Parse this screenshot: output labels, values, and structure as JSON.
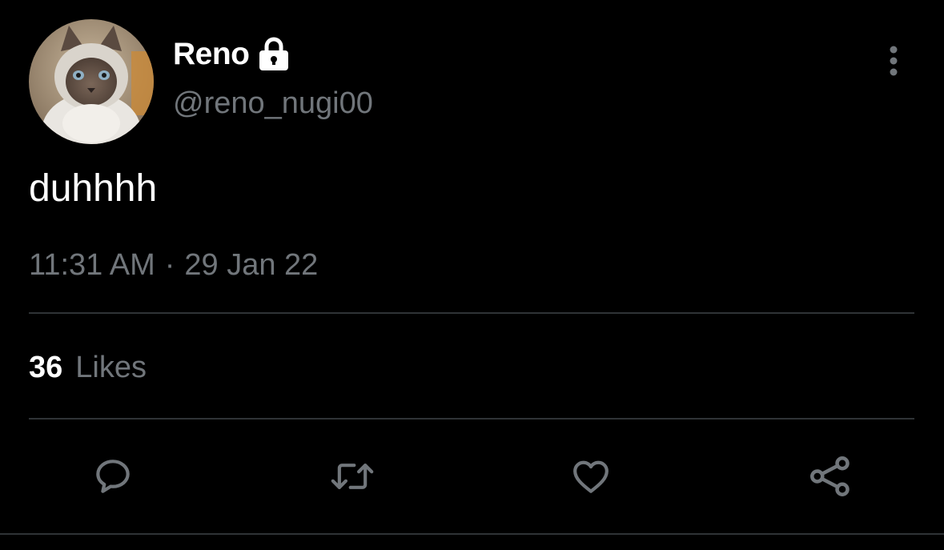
{
  "tweet": {
    "author": {
      "display_name": "Reno",
      "handle": "@reno_nugi00",
      "protected_icon": "lock-icon",
      "avatar": "cat-avatar"
    },
    "text": "duhhhh",
    "time": "11:31 AM",
    "separator": "·",
    "date": "29 Jan 22",
    "likes_count": "36",
    "likes_label": "Likes",
    "more_icon": "vertical-ellipsis-icon",
    "actions": [
      "reply-icon",
      "retweet-icon",
      "like-icon",
      "share-icon"
    ]
  },
  "colors": {
    "background": "#000000",
    "primary_text": "#ffffff",
    "secondary_text": "#71767b",
    "divider": "#2f3336",
    "icon": "#71767b"
  }
}
